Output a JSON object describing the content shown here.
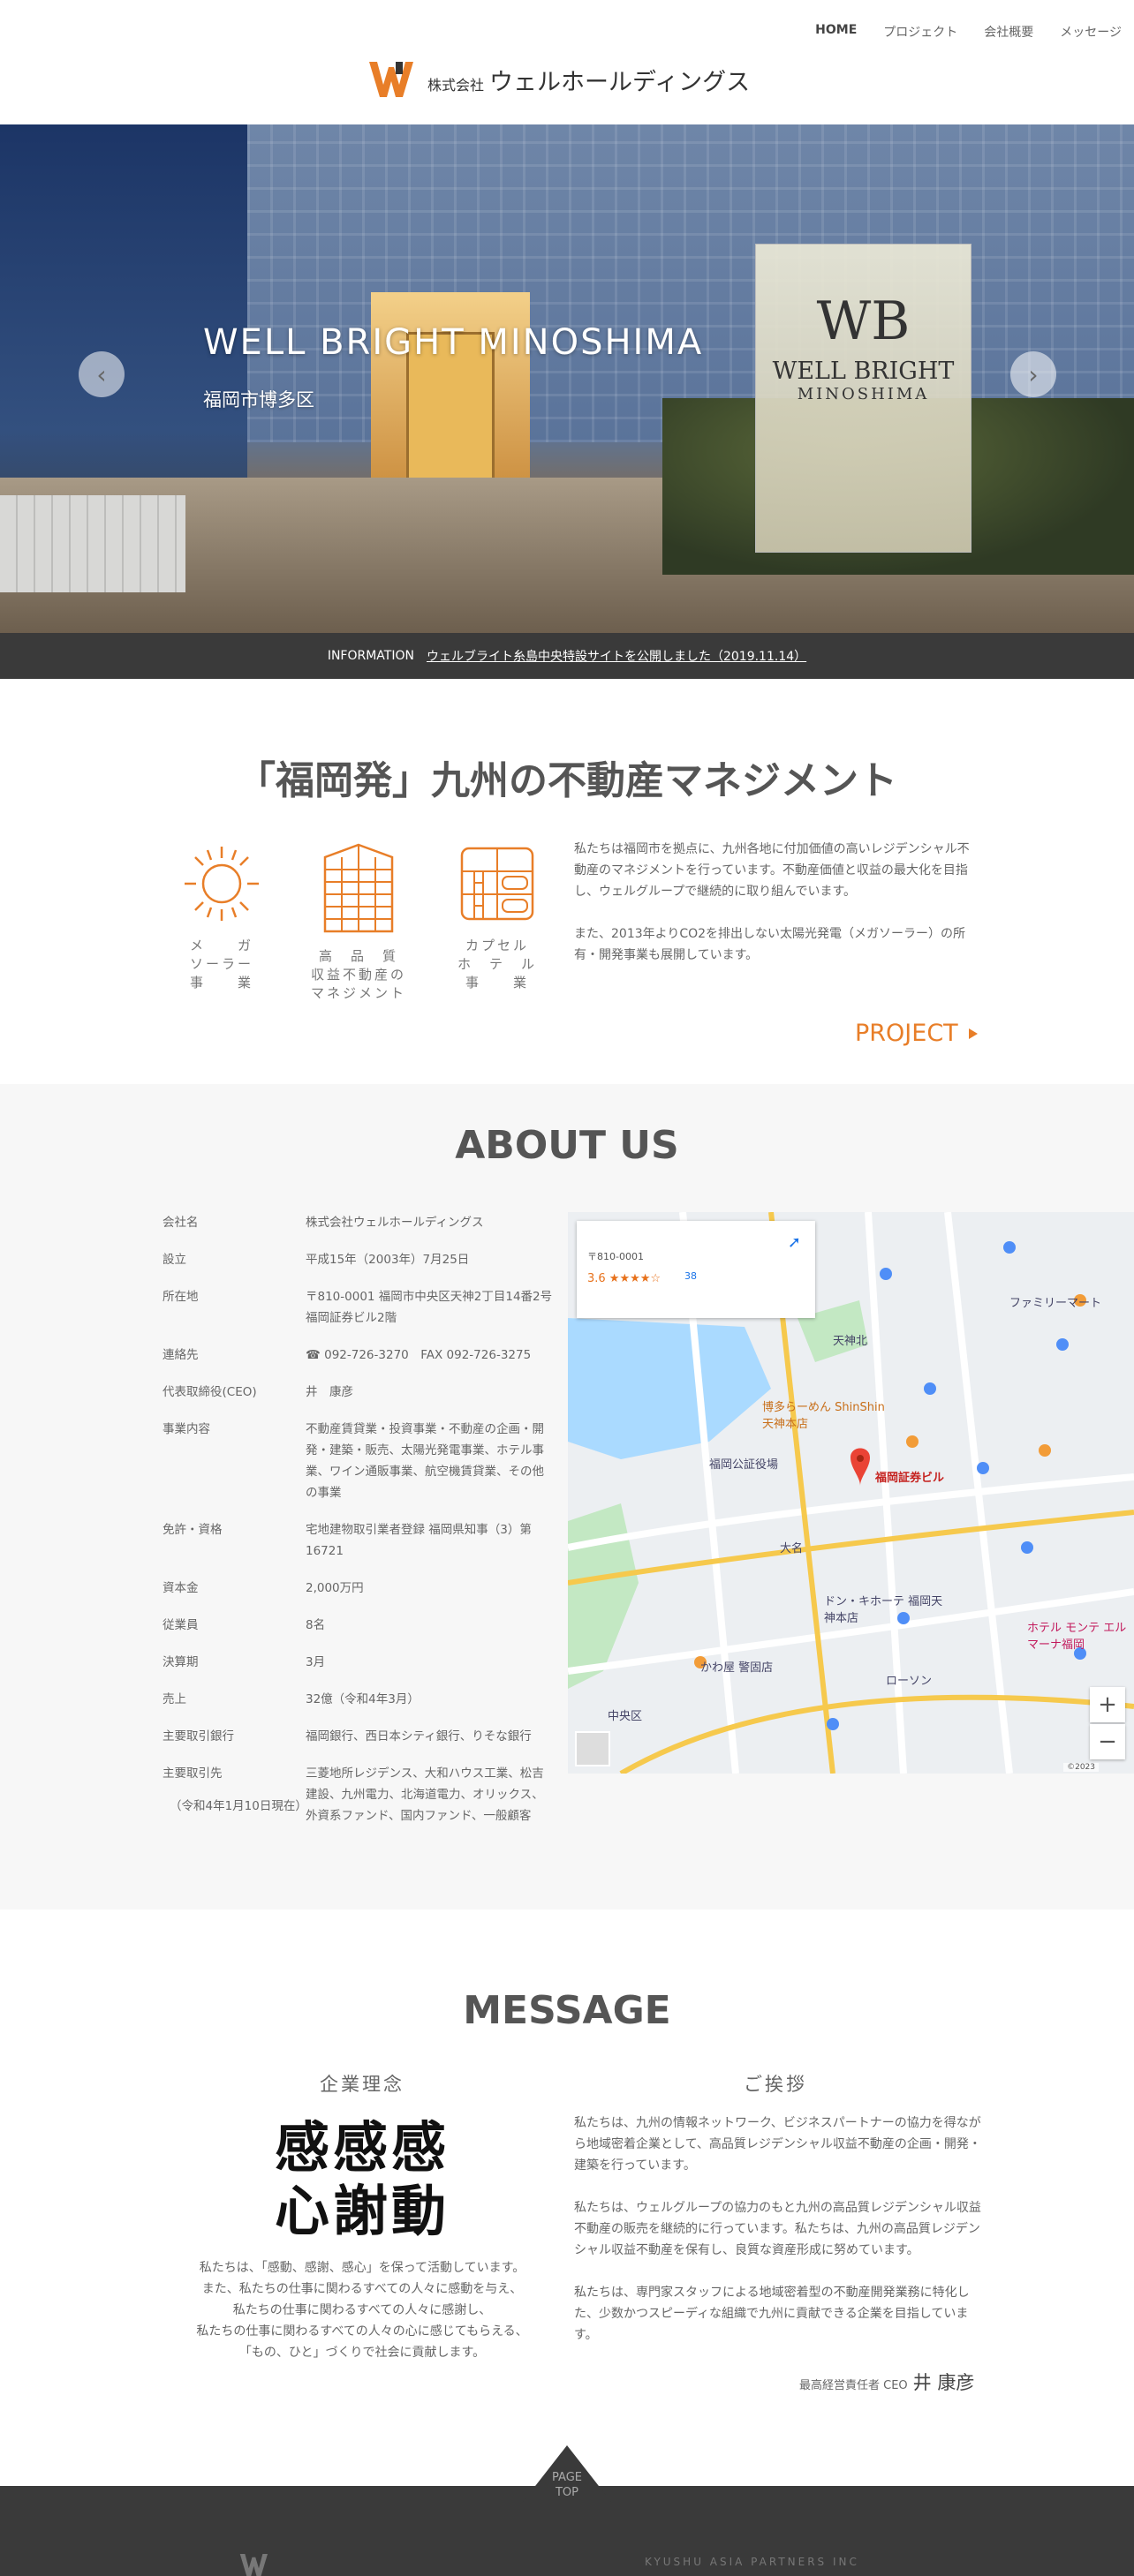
{
  "nav": {
    "items": [
      "HOME",
      "プロジェクト",
      "会社概要",
      "メッセージ"
    ]
  },
  "logo": {
    "prefix": "株式会社",
    "name": "ウェルホールディングス"
  },
  "hero": {
    "title": "WELL BRIGHT MINOSHIMA",
    "subtitle": "福岡市博多区",
    "sign_line1": "WELL BRIGHT",
    "sign_line2": "MINOSHIMA",
    "sign_mark": "WB"
  },
  "info": {
    "label": "INFORMATION",
    "link": "ウェルブライト糸島中央特設サイトを公開しました（2019.11.14）"
  },
  "intro": {
    "title": "「福岡発」九州の不動産マネジメント",
    "businesses": [
      {
        "lines": [
          "メ　　ガ",
          "ソーラー",
          "事　　業"
        ],
        "icon": "sun-icon"
      },
      {
        "lines": [
          "高　品　質",
          "収益不動産の",
          "マネジメント"
        ],
        "icon": "building-icon"
      },
      {
        "lines": [
          "カプセル",
          "ホ　テ　ル",
          "事　　業"
        ],
        "icon": "capsule-hotel-icon"
      }
    ],
    "paragraphs": [
      "私たちは福岡市を拠点に、九州各地に付加価値の高いレジデンシャル不動産のマネジメントを行っています。不動産価値と収益の最大化を目指し、ウェルグループで継続的に取り組んでいます。",
      "また、2013年よりCO2を排出しない太陽光発電（メガソーラー）の所有・開発事業も展開しています。"
    ],
    "project_link": "PROJECT"
  },
  "about": {
    "title": "ABOUT US",
    "rows": [
      {
        "k": "会社名",
        "v": "株式会社ウェルホールディングス"
      },
      {
        "k": "設立",
        "v": "平成15年（2003年）7月25日"
      },
      {
        "k": "所在地",
        "v": "〒810-0001 福岡市中央区天神2丁目14番2号 福岡証券ビル2階"
      },
      {
        "k": "連絡先",
        "v": "☎ 092-726-3270　FAX 092-726-3275"
      },
      {
        "k": "代表取締役(CEO)",
        "v": "井　康彦"
      },
      {
        "k": "事業内容",
        "v": "不動産賃貸業・投資事業・不動産の企画・開発・建築・販売、太陽光発電事業、ホテル事業、ワイン通販事業、航空機賃貸業、その他の事業"
      },
      {
        "k": "免許・資格",
        "v": "宅地建物取引業者登録 福岡県知事（3）第16721"
      },
      {
        "k": "資本金",
        "v": "2,000万円"
      },
      {
        "k": "従業員",
        "v": "8名"
      },
      {
        "k": "決算期",
        "v": "3月"
      },
      {
        "k": "売上",
        "v": "32億（令和4年3月）"
      },
      {
        "k": "主要取引銀行",
        "v": "福岡銀行、西日本シティ銀行、りそな銀行"
      },
      {
        "k": "主要取引先",
        "v": "三菱地所レジデンス、大和ハウス工業、松吉建設、九州電力、北海道電力、オリックス、外資系ファンド、国内ファンド、一般顧客"
      }
    ],
    "as_of": "（令和4年1月10日現在）",
    "map": {
      "card_addr": "〒810-0001",
      "rating": "3.6 ★★★★☆",
      "reviews": "38",
      "marker": "福岡証券ビル",
      "labels": [
        "ファミリーマート",
        "中央区",
        "大名",
        "ドン・キホーテ 福岡天神本店",
        "博多らーめん ShinShin 天神本店",
        "ローソン",
        "天神北",
        "福岡公証役場",
        "かわ屋 警固店",
        "ホテル モンテ エルマーナ福岡"
      ],
      "credit": "©2023"
    }
  },
  "message": {
    "title": "MESSAGE",
    "philosophy_heading": "企業理念",
    "calligraphy": [
      "感感感",
      "心謝動"
    ],
    "philosophy_lines": [
      "私たちは、「感動、感謝、感心」を保って活動しています。",
      "また、私たちの仕事に関わるすべての人々に感動を与え、",
      "私たちの仕事に関わるすべての人々に感謝し、",
      "私たちの仕事に関わるすべての人々の心に感じてもらえる、",
      "「もの、ひと」づくりで社会に貢献します。"
    ],
    "greeting_heading": "ご挨拶",
    "greeting_paragraphs": [
      "私たちは、九州の情報ネットワーク、ビジネスパートナーの協力を得ながら地域密着企業として、高品質レジデンシャル収益不動産の企画・開発・建築を行っています。",
      "私たちは、ウェルグループの協力のもと九州の高品質レジデンシャル収益不動産の販売を継続的に行っています。私たちは、九州の高品質レジデンシャル収益不動産を保有し、良質な資産形成に努めています。",
      "私たちは、専門家スタッフによる地域密着型の不動産開発業務に特化した、少数かつスピーディな組織で九州に貢献できる企業を目指しています。"
    ],
    "sign_title": "最高経営責任者 CEO",
    "sign_name": "井 康彦"
  },
  "footer": {
    "pagetop": [
      "PAGE",
      "TOP"
    ],
    "partner": "KYUSHU ASIA PARTNERS INC"
  },
  "colors": {
    "accent": "#e87e28",
    "dark": "#3a3a3a",
    "light_bg": "#f7f7f7"
  }
}
